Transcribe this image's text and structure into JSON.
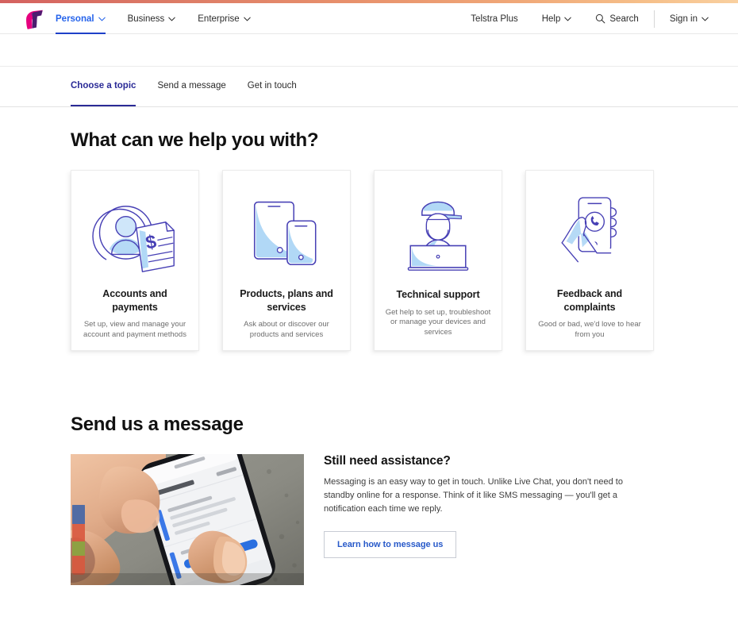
{
  "brand": {
    "logo_name": "telstra-t-logo",
    "logo_magenta": "#e6007e",
    "logo_purple": "#4b1d6e"
  },
  "theme": {
    "accent_blue": "#2563eb",
    "tab_navy": "#2a2a96",
    "link_blue": "#2759c9",
    "illustration_stroke": "#4740b5",
    "illustration_fill": "#a9d4f5",
    "top_gradient_from": "#d4615f",
    "top_gradient_to": "#f9d0a0"
  },
  "header": {
    "left_nav": [
      {
        "label": "Personal",
        "has_chevron": true,
        "active": true
      },
      {
        "label": "Business",
        "has_chevron": true,
        "active": false
      },
      {
        "label": "Enterprise",
        "has_chevron": true,
        "active": false
      }
    ],
    "right_nav": [
      {
        "label": "Telstra Plus",
        "icon": "",
        "has_chevron": false
      },
      {
        "label": "Help",
        "icon": "",
        "has_chevron": true
      },
      {
        "label": "Search",
        "icon": "search-icon",
        "has_chevron": false
      },
      {
        "label": "Sign in",
        "icon": "",
        "has_chevron": true
      }
    ]
  },
  "tabbar": {
    "tabs": [
      {
        "label": "Choose a topic",
        "active": true
      },
      {
        "label": "Send a message",
        "active": false
      },
      {
        "label": "Get in touch",
        "active": false
      }
    ]
  },
  "topics": {
    "heading": "What can we help you with?",
    "cards": [
      {
        "title": "Accounts and payments",
        "desc": "Set up, view and manage your account and payment methods",
        "art": "account-invoice-illustration"
      },
      {
        "title": "Products, plans and services",
        "desc": "Ask about or discover our products and services",
        "art": "tablet-phone-illustration"
      },
      {
        "title": "Technical support",
        "desc": "Get help to set up, troubleshoot or manage your devices and services",
        "art": "technician-laptop-illustration"
      },
      {
        "title": "Feedback and complaints",
        "desc": "Good or bad, we'd love to hear from you",
        "art": "hand-phone-call-illustration"
      }
    ]
  },
  "message_section": {
    "heading": "Send us a message",
    "photo_alt": "hands-holding-smartphone-photo",
    "sub_heading": "Still need assistance?",
    "body": "Messaging is an easy way to get in touch. Unlike Live Chat, you don't need to standby online for a response. Think of it like SMS messaging — you'll get a notification each time we reply.",
    "button_label": "Learn how to message us"
  }
}
